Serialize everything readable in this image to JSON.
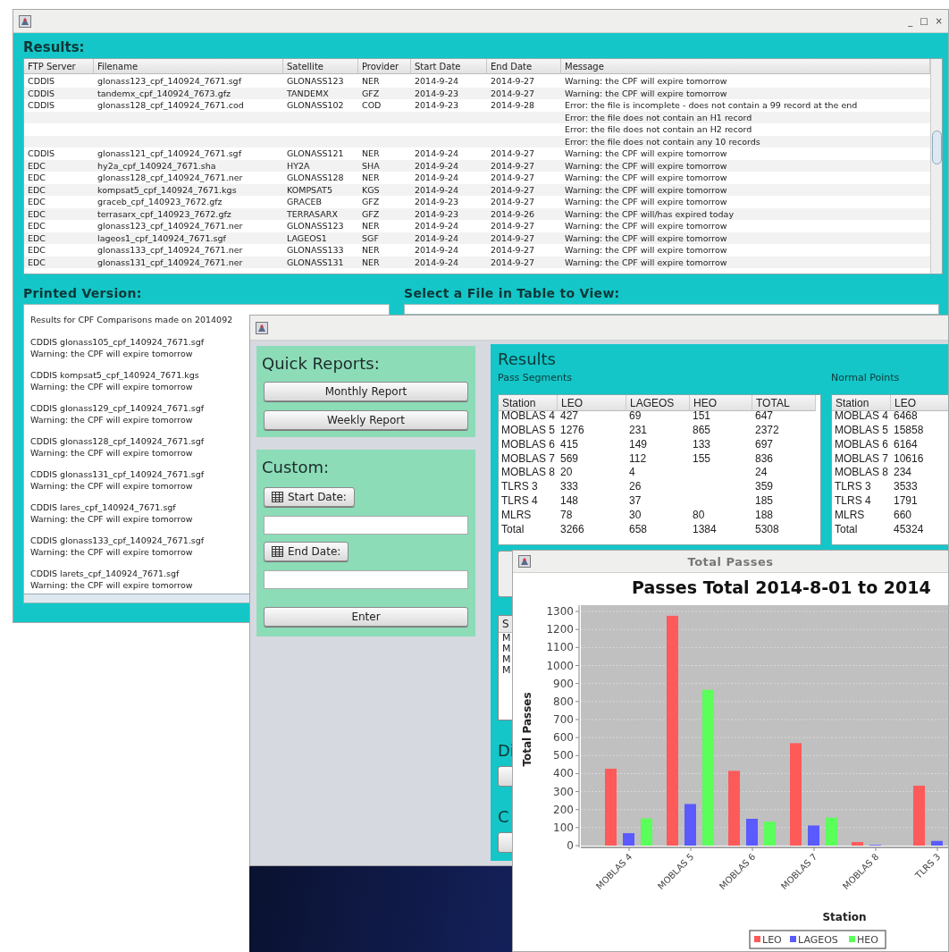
{
  "main_window": {
    "window_buttons": [
      "_",
      "□",
      "×"
    ],
    "results_heading": "Results:",
    "table": {
      "columns": [
        "FTP Server",
        "Filename",
        "Satellite",
        "Provider",
        "Start Date",
        "End Date",
        "Message"
      ],
      "rows": [
        {
          "ftp_server": "CDDIS",
          "filename": "glonass123_cpf_140924_7671.sgf",
          "satellite": "GLONASS123",
          "provider": "NER",
          "start_date": "2014-9-24",
          "end_date": "2014-9-27",
          "message": "Warning: the CPF will expire tomorrow"
        },
        {
          "ftp_server": "CDDIS",
          "filename": "tandemx_cpf_140924_7673.gfz",
          "satellite": "TANDEMX",
          "provider": "GFZ",
          "start_date": "2014-9-23",
          "end_date": "2014-9-27",
          "message": "Warning: the CPF will expire tomorrow"
        },
        {
          "ftp_server": "CDDIS",
          "filename": "glonass128_cpf_140924_7671.cod",
          "satellite": "GLONASS102",
          "provider": "COD",
          "start_date": "2014-9-23",
          "end_date": "2014-9-28",
          "message": "Error: the file is incomplete - does not contain a 99 record at the end"
        },
        {
          "message": "Error: the file does not contain an H1 record"
        },
        {
          "message": "Error: the file does not contain an H2 record"
        },
        {
          "message": "Error: the file does not contain any 10 records"
        },
        {
          "ftp_server": "CDDIS",
          "filename": "glonass121_cpf_140924_7671.sgf",
          "satellite": "GLONASS121",
          "provider": "NER",
          "start_date": "2014-9-24",
          "end_date": "2014-9-27",
          "message": "Warning: the CPF will expire tomorrow"
        },
        {
          "ftp_server": "EDC",
          "filename": "hy2a_cpf_140924_7671.sha",
          "satellite": "HY2A",
          "provider": "SHA",
          "start_date": "2014-9-24",
          "end_date": "2014-9-27",
          "message": "Warning: the CPF will expire tomorrow"
        },
        {
          "ftp_server": "EDC",
          "filename": "glonass128_cpf_140924_7671.ner",
          "satellite": "GLONASS128",
          "provider": "NER",
          "start_date": "2014-9-24",
          "end_date": "2014-9-27",
          "message": "Warning: the CPF will expire tomorrow"
        },
        {
          "ftp_server": "EDC",
          "filename": "kompsat5_cpf_140924_7671.kgs",
          "satellite": "KOMPSAT5",
          "provider": "KGS",
          "start_date": "2014-9-24",
          "end_date": "2014-9-27",
          "message": "Warning: the CPF will expire tomorrow"
        },
        {
          "ftp_server": "EDC",
          "filename": "graceb_cpf_140923_7672.gfz",
          "satellite": "GRACEB",
          "provider": "GFZ",
          "start_date": "2014-9-23",
          "end_date": "2014-9-27",
          "message": "Warning: the CPF will expire tomorrow"
        },
        {
          "ftp_server": "EDC",
          "filename": "terrasarx_cpf_140923_7672.gfz",
          "satellite": "TERRASARX",
          "provider": "GFZ",
          "start_date": "2014-9-23",
          "end_date": "2014-9-26",
          "message": "Warning: the CPF will/has expired today"
        },
        {
          "ftp_server": "EDC",
          "filename": "glonass123_cpf_140924_7671.ner",
          "satellite": "GLONASS123",
          "provider": "NER",
          "start_date": "2014-9-24",
          "end_date": "2014-9-27",
          "message": "Warning: the CPF will expire tomorrow"
        },
        {
          "ftp_server": "EDC",
          "filename": "lageos1_cpf_140924_7671.sgf",
          "satellite": "LAGEOS1",
          "provider": "SGF",
          "start_date": "2014-9-24",
          "end_date": "2014-9-27",
          "message": "Warning: the CPF will expire tomorrow"
        },
        {
          "ftp_server": "EDC",
          "filename": "glonass133_cpf_140924_7671.ner",
          "satellite": "GLONASS133",
          "provider": "NER",
          "start_date": "2014-9-24",
          "end_date": "2014-9-27",
          "message": "Warning: the CPF will expire tomorrow"
        },
        {
          "ftp_server": "EDC",
          "filename": "glonass131_cpf_140924_7671.ner",
          "satellite": "GLONASS131",
          "provider": "NER",
          "start_date": "2014-9-24",
          "end_date": "2014-9-27",
          "message": "Warning: the CPF will expire tomorrow"
        }
      ]
    },
    "printed_version": {
      "heading": "Printed Version:",
      "first_line": "Results for CPF Comparisons made on 2014092",
      "entries": [
        {
          "file": "CDDIS glonass105_cpf_140924_7671.sgf",
          "message": "Warning: the CPF will expire tomorrow"
        },
        {
          "file": "CDDIS kompsat5_cpf_140924_7671.kgs",
          "message": "Warning: the CPF will expire tomorrow"
        },
        {
          "file": "CDDIS glonass129_cpf_140924_7671.sgf",
          "message": "Warning: the CPF will expire tomorrow"
        },
        {
          "file": "CDDIS glonass128_cpf_140924_7671.sgf",
          "message": "Warning: the CPF will expire tomorrow"
        },
        {
          "file": "CDDIS glonass131_cpf_140924_7671.sgf",
          "message": "Warning: the CPF will expire tomorrow"
        },
        {
          "file": "CDDIS lares_cpf_140924_7671.sgf",
          "message": "Warning: the CPF will expire tomorrow"
        },
        {
          "file": "CDDIS glonass133_cpf_140924_7671.sgf",
          "message": "Warning: the CPF will expire tomorrow"
        },
        {
          "file": "CDDIS larets_cpf_140924_7671.sgf",
          "message": "Warning: the CPF will expire tomorrow"
        }
      ]
    },
    "file_view": {
      "heading": "Select a File in Table to View:"
    }
  },
  "report_window": {
    "quick_reports": {
      "heading": "Quick Reports:",
      "buttons": [
        "Monthly Report",
        "Weekly Report"
      ]
    },
    "custom": {
      "heading": "Custom:",
      "start_button": "Start Date:",
      "end_button": "End Date:",
      "enter_button": "Enter"
    },
    "results": {
      "heading": "Results",
      "pass_segments": {
        "title": "Pass Segments",
        "columns": [
          "Station",
          "LEO",
          "LAGEOS",
          "HEO",
          "TOTAL"
        ],
        "rows": [
          [
            "MOBLAS 4",
            "427",
            "69",
            "151",
            "647"
          ],
          [
            "MOBLAS 5",
            "1276",
            "231",
            "865",
            "2372"
          ],
          [
            "MOBLAS 6",
            "415",
            "149",
            "133",
            "697"
          ],
          [
            "MOBLAS 7",
            "569",
            "112",
            "155",
            "836"
          ],
          [
            "MOBLAS 8",
            "20",
            "4",
            "",
            "24"
          ],
          [
            "TLRS 3",
            "333",
            "26",
            "",
            "359"
          ],
          [
            "TLRS 4",
            "148",
            "37",
            "",
            "185"
          ],
          [
            "MLRS",
            "78",
            "30",
            "80",
            "188"
          ],
          [
            "Total",
            "3266",
            "658",
            "1384",
            "5308"
          ]
        ]
      },
      "normal_points": {
        "title": "Normal Points",
        "columns": [
          "Station",
          "LEO"
        ],
        "rows": [
          [
            "MOBLAS 4",
            "6468"
          ],
          [
            "MOBLAS 5",
            "15858"
          ],
          [
            "MOBLAS 6",
            "6164"
          ],
          [
            "MOBLAS 7",
            "10616"
          ],
          [
            "MOBLAS 8",
            "234"
          ],
          [
            "TLRS 3",
            "3533"
          ],
          [
            "TLRS 4",
            "1791"
          ],
          [
            "MLRS",
            "660"
          ],
          [
            "Total",
            "45324"
          ]
        ]
      },
      "lower_table": {
        "column_1": "S",
        "rows": [
          "M",
          "M",
          "M",
          "M"
        ]
      },
      "section_1": "Di",
      "section_2": "C"
    }
  },
  "chart_window": {
    "title": "Total Passes",
    "chart_data": {
      "type": "bar",
      "title": "Passes Total 2014-8-01 to 2014",
      "xlabel": "Station",
      "ylabel": "Total Passes",
      "categories": [
        "MOBLAS 4",
        "MOBLAS 5",
        "MOBLAS 6",
        "MOBLAS 7",
        "MOBLAS 8",
        "TLRS 3"
      ],
      "series": [
        {
          "name": "LEO",
          "color": "#ff5a5a",
          "values": [
            427,
            1276,
            415,
            569,
            20,
            333
          ]
        },
        {
          "name": "LAGEOS",
          "color": "#5a5aff",
          "values": [
            69,
            231,
            149,
            112,
            4,
            26
          ]
        },
        {
          "name": "HEO",
          "color": "#5aff5a",
          "values": [
            151,
            865,
            133,
            155,
            null,
            null
          ]
        }
      ],
      "grid": true,
      "legend": "bottom",
      "ylim": [
        0,
        1335
      ],
      "yticks": [
        0,
        100,
        200,
        300,
        400,
        500,
        600,
        700,
        800,
        900,
        1000,
        1100,
        1200,
        1300
      ]
    }
  }
}
